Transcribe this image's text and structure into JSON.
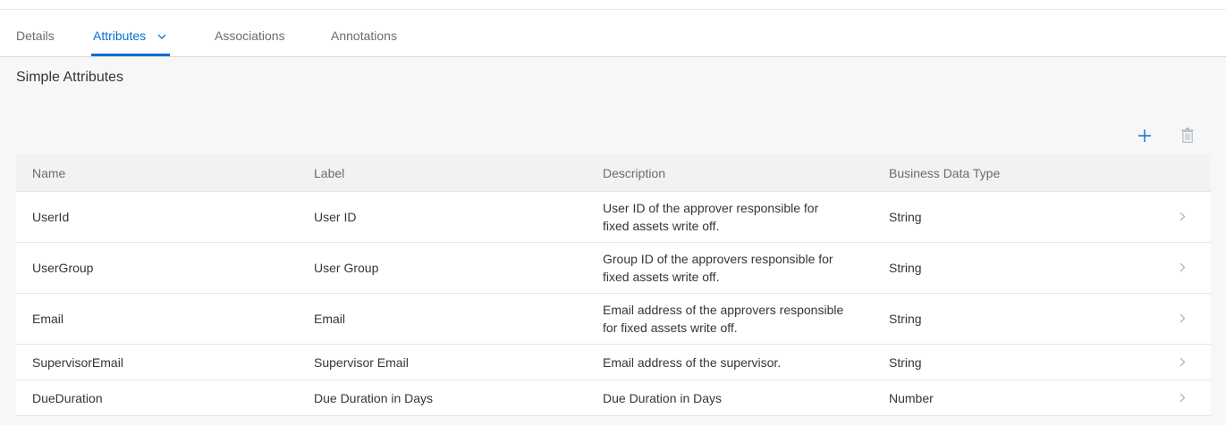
{
  "tabs": [
    {
      "label": "Details"
    },
    {
      "label": "Attributes"
    },
    {
      "label": "Associations"
    },
    {
      "label": "Annotations"
    }
  ],
  "section": {
    "title": "Simple Attributes"
  },
  "toolbar": {
    "add_icon": "plus-icon",
    "delete_icon": "trash-icon"
  },
  "table": {
    "columns": [
      "Name",
      "Label",
      "Description",
      "Business Data Type"
    ],
    "rows": [
      {
        "name": "UserId",
        "label": "User ID",
        "description": "User ID of the approver responsible for fixed assets write off.",
        "type": "String"
      },
      {
        "name": "UserGroup",
        "label": "User Group",
        "description": "Group ID of the approvers responsible for fixed assets write off.",
        "type": "String"
      },
      {
        "name": "Email",
        "label": "Email",
        "description": "Email address of the approvers responsible for fixed assets write off.",
        "type": "String"
      },
      {
        "name": "SupervisorEmail",
        "label": "Supervisor Email",
        "description": "Email address of the supervisor.",
        "type": "String"
      },
      {
        "name": "DueDuration",
        "label": "Due Duration in Days",
        "description": "Due Duration in Days",
        "type": "Number"
      }
    ]
  },
  "colors": {
    "accent": "#0a6ed1",
    "text": "#32363a",
    "muted": "#6a6d70",
    "background": "#f7f7f7"
  }
}
